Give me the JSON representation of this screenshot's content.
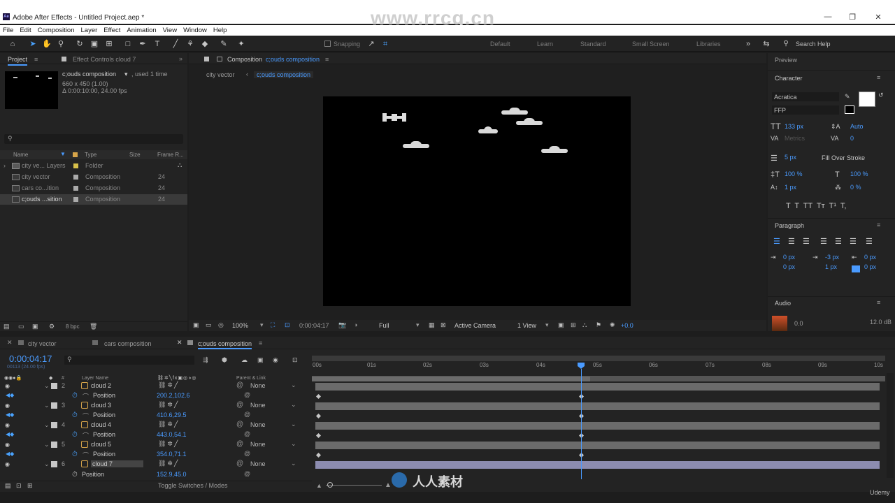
{
  "window": {
    "title": "Adobe After Effects - Untitled Project.aep *",
    "logo": "Ae",
    "watermark": "www.rrcg.cn",
    "minimize": "—",
    "maximize": "❐",
    "close": "✕"
  },
  "menu": [
    "File",
    "Edit",
    "Composition",
    "Layer",
    "Effect",
    "Animation",
    "View",
    "Window",
    "Help"
  ],
  "toolbar": {
    "snapping": "Snapping",
    "workspaces": [
      "Default",
      "Learn",
      "Standard",
      "Small Screen",
      "Libraries"
    ],
    "search_placeholder": "Search Help"
  },
  "project": {
    "tab": "Project",
    "effect_tab": "Effect Controls cloud 7",
    "comp_name": "c;ouds composition",
    "used": ", used 1 time",
    "size": "660 x 450 (1.00)",
    "duration": "Δ 0:00:10:00, 24.00 fps",
    "columns": {
      "name": "Name",
      "type": "Type",
      "size": "Size",
      "frame": "Frame R..."
    },
    "items": [
      {
        "name": "city ve... Layers",
        "type": "Folder",
        "size": ""
      },
      {
        "name": "city vector",
        "type": "Composition",
        "size": "24"
      },
      {
        "name": "cars co...ition",
        "type": "Composition",
        "size": "24"
      },
      {
        "name": "c;ouds ...sition",
        "type": "Composition",
        "size": "24"
      }
    ],
    "bpc": "8 bpc"
  },
  "composition": {
    "tab_prefix": "Composition",
    "tab_name": "c;ouds composition",
    "breadcrumb": [
      "city vector",
      "c;ouds composition"
    ],
    "zoom": "100%",
    "time": "0:00:04:17",
    "resolution": "Full",
    "camera": "Active Camera",
    "views": "1 View",
    "exposure": "+0.0"
  },
  "right": {
    "preview": "Preview",
    "character": "Character",
    "font": "Acratica",
    "style": "FFP",
    "size": "133 px",
    "leading": "Auto",
    "kerning": "Metrics",
    "tracking": "0",
    "stroke": "5 px",
    "stroke_mode": "Fill Over Stroke",
    "vscale": "100 %",
    "hscale": "100 %",
    "baseline": "1 px",
    "tsume": "0 %",
    "styles": "T  T  TT  Tт  T¹  T,",
    "paragraph": "Paragraph",
    "indent_left": "0 px",
    "indent_right": "0 px",
    "indent_first": "-3 px",
    "space_before": "0 px",
    "space_after": "1 px",
    "space_extra": "0 px",
    "audio": "Audio",
    "audio_left": "0.0",
    "audio_right": "12.0 dB"
  },
  "timeline": {
    "tabs": [
      "city vector",
      "cars composition",
      "c;ouds composition"
    ],
    "time": "0:00:04:17",
    "frames": "00113 (24.00 fps)",
    "col_layer": "Layer Name",
    "col_parent": "Parent & Link",
    "ruler": [
      "00s",
      "01s",
      "02s",
      "03s",
      "04s",
      "05s",
      "06s",
      "07s",
      "08s",
      "09s",
      "10s"
    ],
    "layers": [
      {
        "num": "2",
        "name": "cloud 2",
        "pos": "200.2,102.6",
        "parent": "None"
      },
      {
        "num": "3",
        "name": "cloud 3",
        "pos": "410.6,29.5",
        "parent": "None"
      },
      {
        "num": "4",
        "name": "cloud 4",
        "pos": "443.0,54.1",
        "parent": "None"
      },
      {
        "num": "5",
        "name": "cloud 5",
        "pos": "354.0,71.1",
        "parent": "None"
      },
      {
        "num": "6",
        "name": "cloud 7",
        "pos": "152.9,45.0",
        "parent": "None"
      }
    ],
    "position_label": "Position",
    "toggle": "Toggle Switches / Modes",
    "footer_brand": "人人素材",
    "udemy": "Udemy"
  }
}
